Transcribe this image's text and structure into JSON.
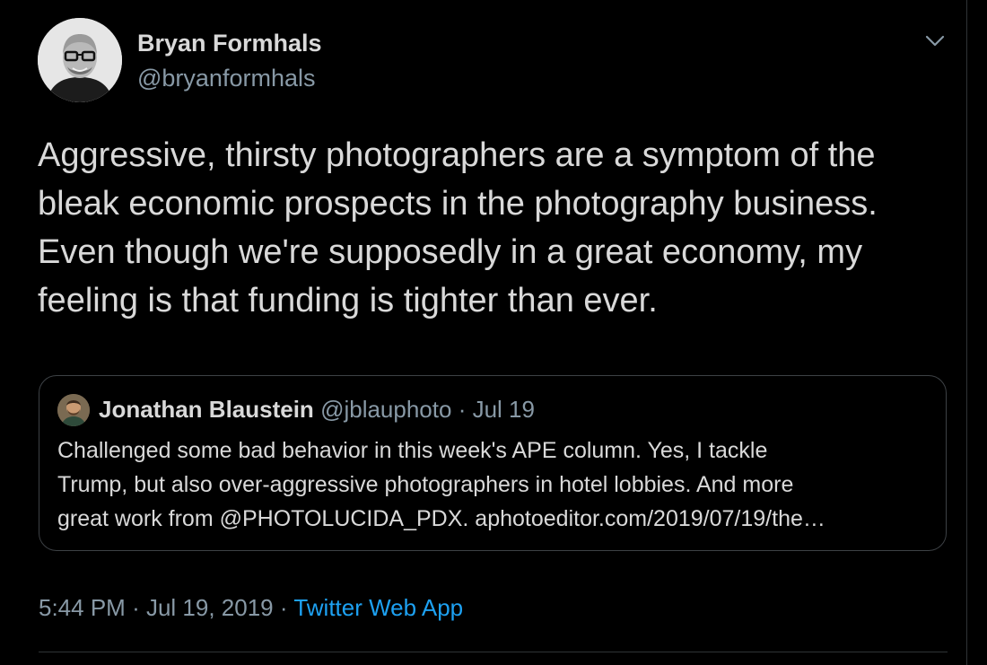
{
  "author": {
    "name": "Bryan Formhals",
    "handle": "@bryanformhals",
    "avatar_icon": "profile-avatar"
  },
  "tweet": {
    "text": "Aggressive, thirsty photographers are a symptom of the\nbleak economic prospects in the photography business.\nEven though we're supposedly in a great economy, my\nfeeling is that funding is tighter than ever."
  },
  "quote": {
    "name": "Jonathan Blaustein",
    "handle": "@jblauphoto",
    "separator": "·",
    "date": "Jul 19",
    "text": "Challenged some bad behavior in this week's APE column. Yes, I tackle\nTrump, but also over-aggressive photographers in hotel lobbies. And more\ngreat work from @PHOTOLUCIDA_PDX. aphotoeditor.com/2019/07/19/the…"
  },
  "meta": {
    "time": "5:44 PM",
    "separator1": "·",
    "date": "Jul 19, 2019",
    "separator2": "·",
    "source": "Twitter Web App"
  },
  "colors": {
    "background": "#000000",
    "text": "#d9d9d9",
    "secondary": "#8899a6",
    "link": "#1da1f2",
    "border": "#3d4145"
  },
  "icons": {
    "menu": "chevron-down-icon"
  }
}
